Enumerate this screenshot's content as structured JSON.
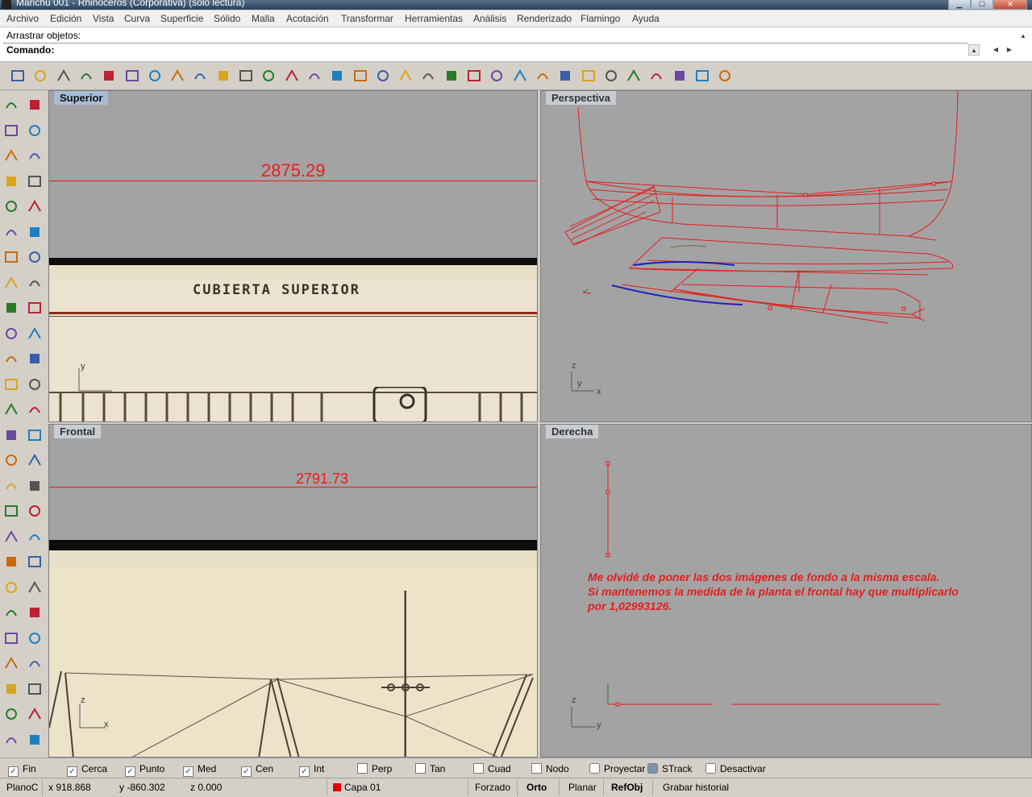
{
  "window": {
    "title": "Marichu 001 - Rhinoceros (Corporativa) (sólo lectura)"
  },
  "menu": [
    "Archivo",
    "Edición",
    "Vista",
    "Curva",
    "Superficie",
    "Sólido",
    "Malla",
    "Acotación",
    "Transformar",
    "Herramientas",
    "Análisis",
    "Renderizado",
    "Flamingo",
    "Ayuda"
  ],
  "command": {
    "history": "Arrastrar objetos:",
    "prompt": "Comando:"
  },
  "toolbar_icons": [
    "new-file-icon",
    "open-folder-icon",
    "save-icon",
    "print-icon",
    "import-icon",
    "cut-icon",
    "copy-icon",
    "paste-icon",
    "undo-icon",
    "pan-hand-icon",
    "rotate-view-icon",
    "zoom-dynamic-icon",
    "zoom-window-icon",
    "zoom-extents-icon",
    "zoom-selected-icon",
    "zoom-all-icon",
    "move-icon",
    "car-icon",
    "mesh-icon",
    "point-icon",
    "snap-icon",
    "shade-icon",
    "printer-icon",
    "materials-icon",
    "color-wheel-icon",
    "layer-icon",
    "grid-icon",
    "sphere-icon",
    "brush-icon",
    "light-icon",
    "dimension-icon",
    "help-icon"
  ],
  "left_tools": [
    "select-arrow-icon",
    "point-icon",
    "polyline-icon",
    "curve-control-icon",
    "circle-icon",
    "ellipse-icon",
    "arc-icon",
    "rectangle-icon",
    "polygon-icon",
    "fillet-icon",
    "surface-icon",
    "revolve-icon",
    "box-icon",
    "sphere-icon",
    "cylinder-icon",
    "plane-surface-icon",
    "solid-tools-icon",
    "extrude-icon",
    "trim-icon",
    "split-icon",
    "boolean-icon",
    "array-icon",
    "curve-tool-icon",
    "offset-icon",
    "text-icon",
    "scale-icon",
    "group-icon",
    "edit-points-icon",
    "mesh-box-icon",
    "dimension-icon",
    "osnap-grid-icon",
    "plane-icon",
    "xyz-icon",
    "named-view-icon",
    "rotate-3d-icon",
    "camera-icon",
    "extend-icon",
    "orient-icon",
    "distance-icon",
    "section-icon",
    "analysis-icon",
    "grid-render-icon",
    "make2d-icon",
    "curvature-icon",
    "question-icon",
    "zebra-icon",
    "control-points-icon",
    "gumball-icon",
    "sun-icon",
    "render-icon",
    "properties-icon",
    "check-icon"
  ],
  "viewports": {
    "top": {
      "label": "Superior",
      "dimension": "2875.29",
      "bg_text": "CUBIERTA SUPERIOR",
      "axis_y": "y"
    },
    "perspective": {
      "label": "Perspectiva",
      "axis_z": "z",
      "axis_y": "y",
      "axis_x": "x"
    },
    "front": {
      "label": "Frontal",
      "dimension": "2791.73",
      "axis_z": "z",
      "axis_x": "x"
    },
    "right": {
      "label": "Derecha",
      "note": [
        "Me olvidé de poner las dos imágenes de fondo a la misma escala.",
        "Si mantenemos la medida de la planta el frontal hay que multiplicarlo",
        "por 1,02993126."
      ],
      "axis_z": "z",
      "axis_y": "y"
    }
  },
  "osnaps": [
    {
      "label": "Fin",
      "checked": true
    },
    {
      "label": "Cerca",
      "checked": true
    },
    {
      "label": "Punto",
      "checked": true
    },
    {
      "label": "Med",
      "checked": true
    },
    {
      "label": "Cen",
      "checked": true
    },
    {
      "label": "Int",
      "checked": true
    },
    {
      "label": "Perp",
      "checked": false
    },
    {
      "label": "Tan",
      "checked": false
    },
    {
      "label": "Cuad",
      "checked": false
    },
    {
      "label": "Nodo",
      "checked": false
    }
  ],
  "osnap_extra": {
    "project": "Proyectar",
    "strack": "STrack",
    "disable": "Desactivar"
  },
  "status": {
    "plane": "PlanoC",
    "x": "x 918.868",
    "y": "y -860.302",
    "z": "z 0.000",
    "layer": "Capa 01",
    "layer_color": "#e00000",
    "snap": "Forzado",
    "ortho": "Orto",
    "planar": "Planar",
    "refobj": "RefObj",
    "history": "Grabar historial"
  },
  "colors": {
    "geometry_red": "#e41e1e",
    "active_label": "#a9bcd6",
    "viewport_bg": "#a3a3a3"
  }
}
